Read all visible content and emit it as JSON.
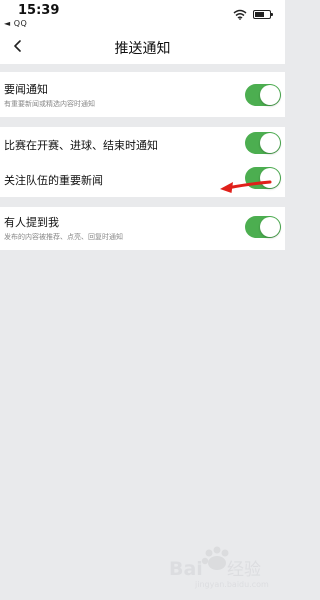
{
  "status_bar": {
    "time": "15:39",
    "back_app": "◄ QQ"
  },
  "nav": {
    "title": "推送通知"
  },
  "settings": [
    {
      "title": "要闻通知",
      "subtitle": "有重要新闻或精选内容时通知",
      "enabled": true
    },
    {
      "title": "比赛在开赛、进球、结束时通知",
      "subtitle": "",
      "enabled": true
    },
    {
      "title": "关注队伍的重要新闻",
      "subtitle": "",
      "enabled": true
    },
    {
      "title": "有人提到我",
      "subtitle": "发布的内容被推荐、点亮、回复时通知",
      "enabled": true
    }
  ],
  "colors": {
    "toggle_on": "#4cae50",
    "annotation_arrow": "#e0201a",
    "background": "#e9eaec"
  },
  "icons": [
    "back-chevron-icon",
    "wifi-icon",
    "battery-icon",
    "annotation-arrow-icon"
  ]
}
